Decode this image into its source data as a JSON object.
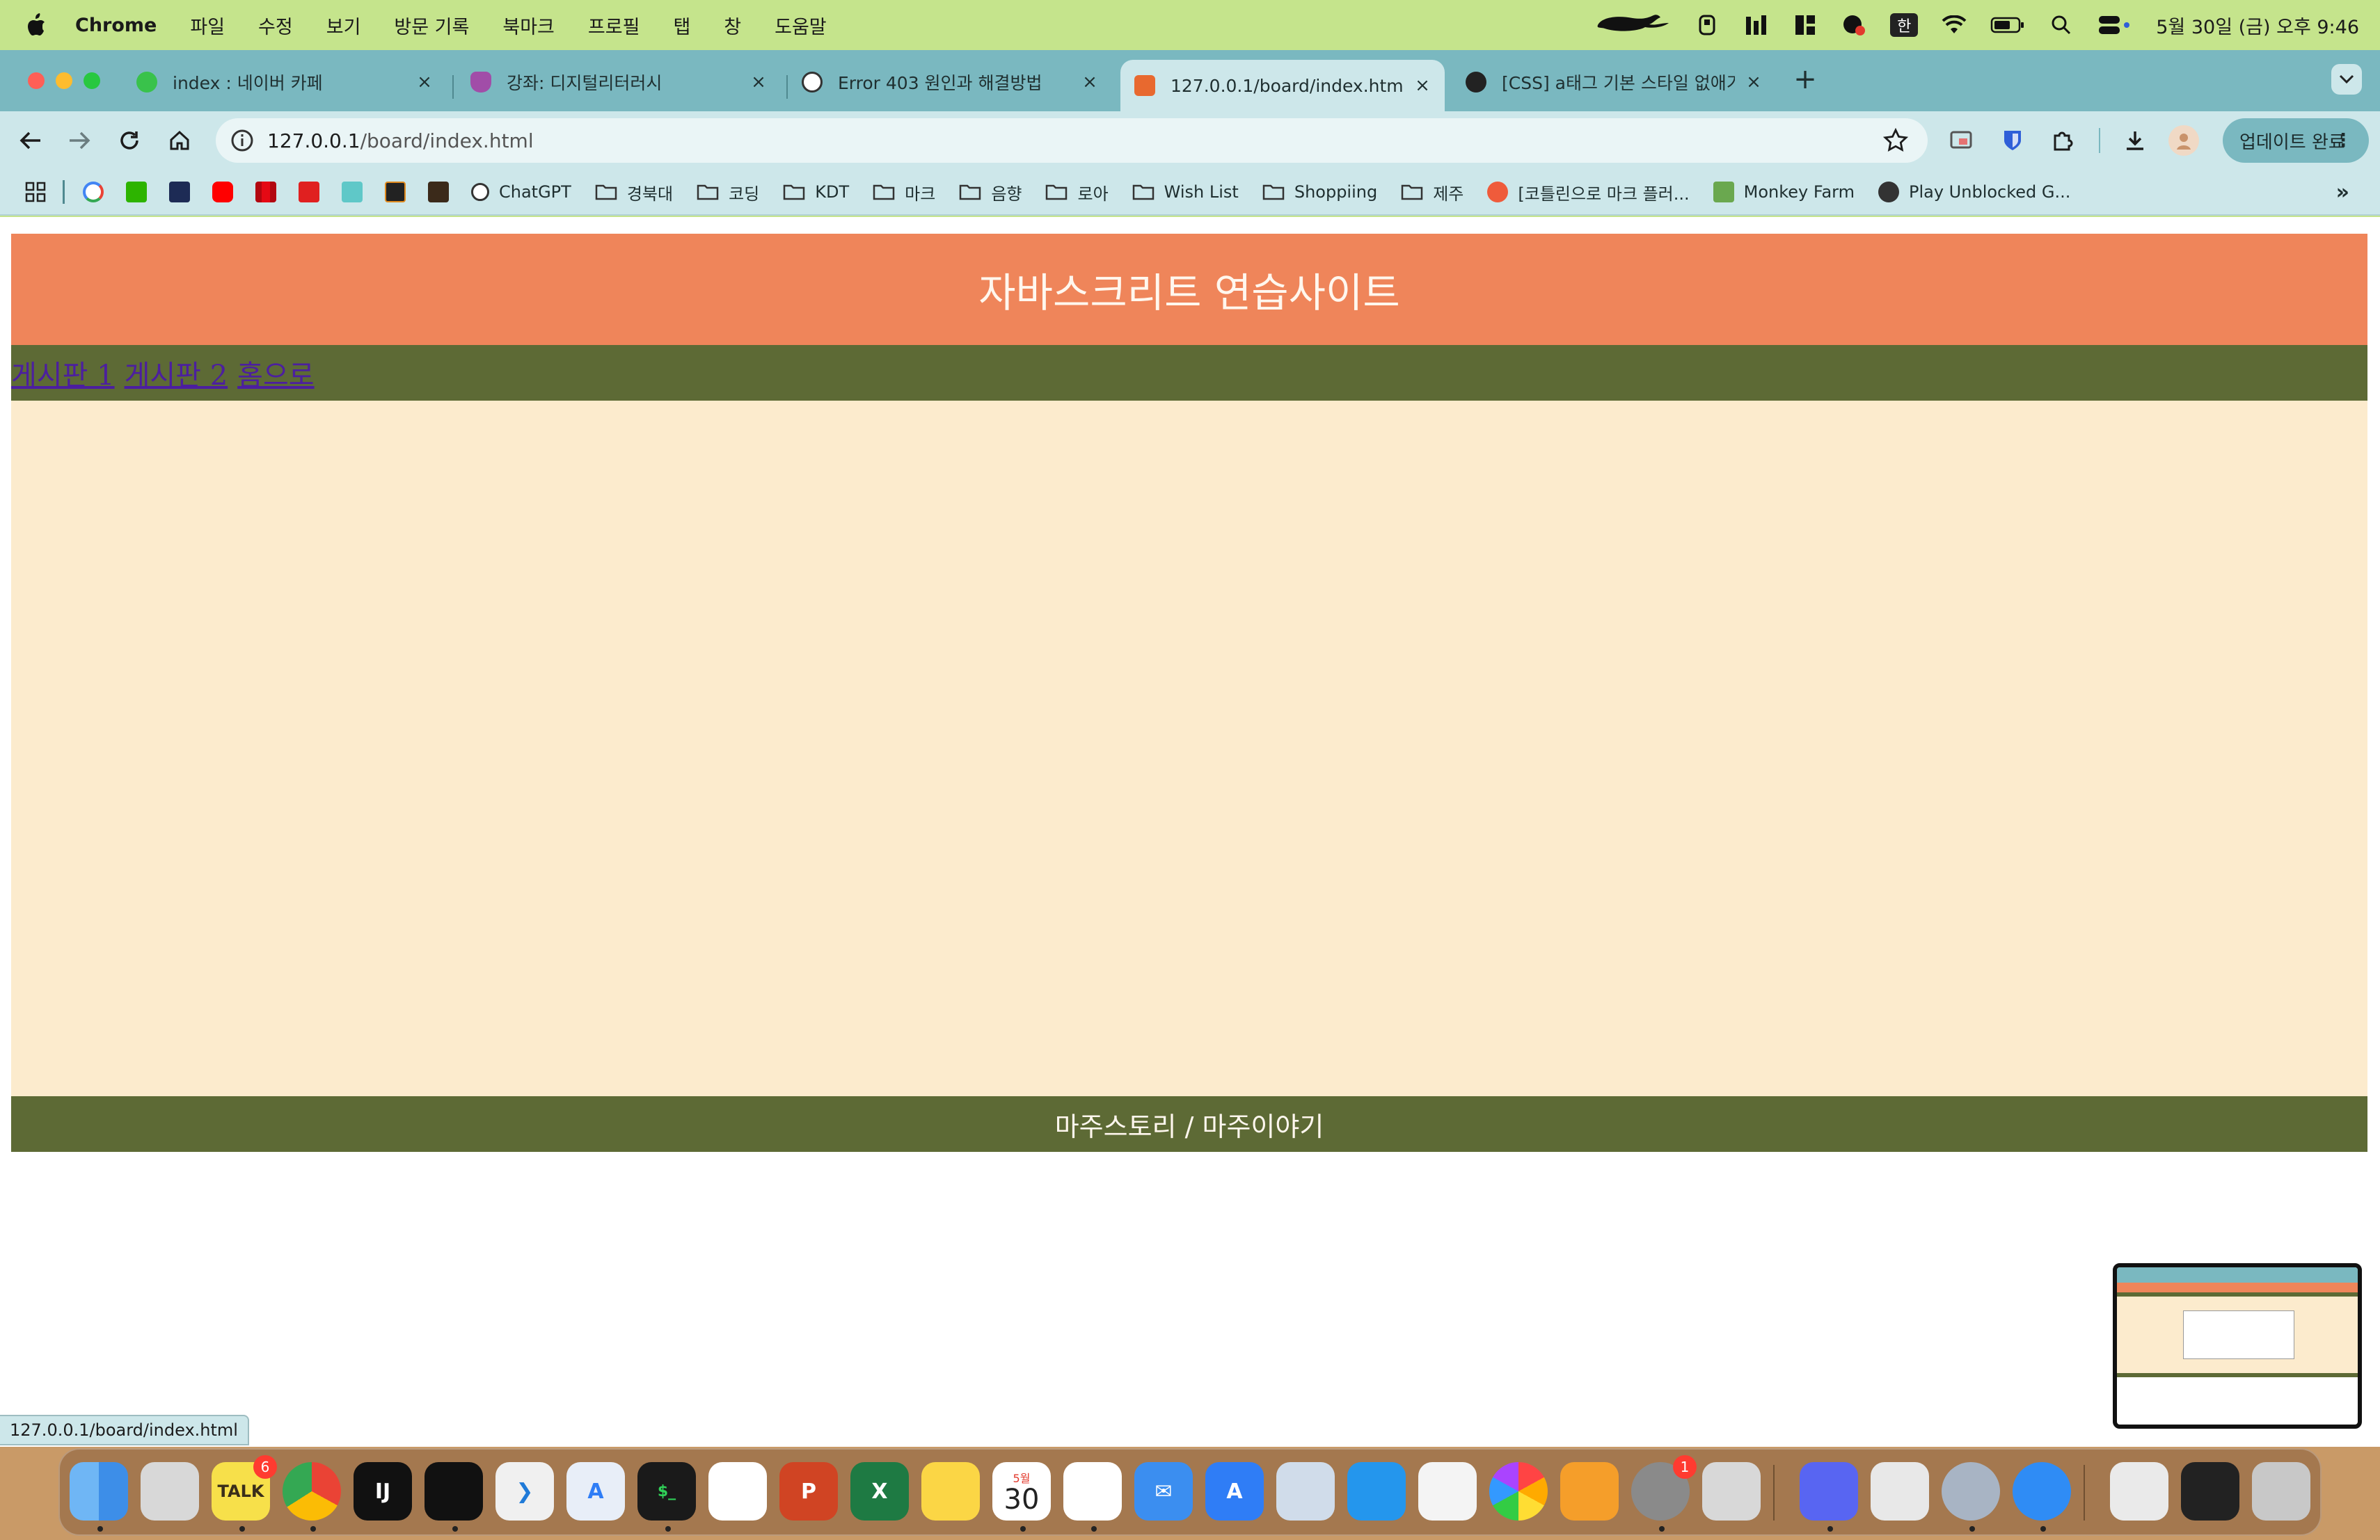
{
  "menubar": {
    "app_name": "Chrome",
    "items": [
      "파일",
      "수정",
      "보기",
      "방문 기록",
      "북마크",
      "프로필",
      "탭",
      "창",
      "도움말"
    ],
    "input_method": "한",
    "clock": "5월 30일 (금) 오후 9:46"
  },
  "tabs": [
    {
      "title": "index : 네이버 카페",
      "icon": "naver-cafe-icon",
      "active": false
    },
    {
      "title": "강좌: 디지털리터러시",
      "icon": "course-shield-icon",
      "active": false
    },
    {
      "title": "Error 403 원인과 해결방법",
      "icon": "openai-icon",
      "active": false
    },
    {
      "title": "127.0.0.1/board/index.html",
      "icon": "html-file-icon",
      "active": true
    },
    {
      "title": "[CSS] a태그 기본 스타일 없애기/...",
      "icon": "paw-icon",
      "active": false
    }
  ],
  "toolbar": {
    "url_host": "127.0.0.1",
    "url_path": "/board/index.html",
    "update_label": "업데이트 완료"
  },
  "bookmarks": [
    {
      "label": "",
      "icon": "google-icon",
      "color": "#ffffff"
    },
    {
      "label": "",
      "icon": "naver-icon",
      "color": "#2db400"
    },
    {
      "label": "",
      "icon": "d-icon",
      "color": "#1d2b55"
    },
    {
      "label": "",
      "icon": "youtube-icon",
      "color": "#ff0000"
    },
    {
      "label": "",
      "icon": "netflix-icon",
      "color": "#cdcdcd"
    },
    {
      "label": "",
      "icon": "v-icon",
      "color": "#e02020"
    },
    {
      "label": "",
      "icon": "teal-square-icon",
      "color": "#5fc8c8"
    },
    {
      "label": "",
      "icon": "m-icon",
      "color": "#222222"
    },
    {
      "label": "",
      "icon": "game-icon",
      "color": "#3b2a1a"
    },
    {
      "label": "ChatGPT",
      "icon": "openai-icon"
    },
    {
      "label": "경북대",
      "icon": "folder-icon"
    },
    {
      "label": "코딩",
      "icon": "folder-icon"
    },
    {
      "label": "KDT",
      "icon": "folder-icon"
    },
    {
      "label": "마크",
      "icon": "folder-icon"
    },
    {
      "label": "음향",
      "icon": "folder-icon"
    },
    {
      "label": "로아",
      "icon": "folder-icon"
    },
    {
      "label": "Wish List",
      "icon": "folder-icon"
    },
    {
      "label": "Shoppiing",
      "icon": "folder-icon"
    },
    {
      "label": "제주",
      "icon": "folder-icon"
    },
    {
      "label": "[코틀린으로 마크 플러...",
      "icon": "tistory-icon"
    },
    {
      "label": "Monkey Farm",
      "icon": "monkey-farm-icon"
    },
    {
      "label": "Play Unblocked G...",
      "icon": "globe-icon"
    }
  ],
  "page": {
    "header_title": "자바스크리트 연습사이트",
    "nav_links": [
      "게시판 1",
      "게시판 2",
      "홈으로"
    ],
    "footer_text": "마주스토리 / 마주이야기"
  },
  "status_url": "127.0.0.1/board/index.html",
  "dock": {
    "apps": [
      {
        "name": "finder-icon",
        "color": "#3d8ee8",
        "label": ""
      },
      {
        "name": "launchpad-icon",
        "color": "#d8d8d8",
        "label": ""
      },
      {
        "name": "kakaotalk-icon",
        "color": "#f7e04a",
        "label": "TALK",
        "badge": "6"
      },
      {
        "name": "chrome-icon",
        "color": "#e8e8e8",
        "label": ""
      },
      {
        "name": "intellij-icon",
        "color": "#111111",
        "label": "IJ"
      },
      {
        "name": "unity-icon",
        "color": "#111111",
        "label": ""
      },
      {
        "name": "vscode-icon",
        "color": "#f0f0f0",
        "label": ""
      },
      {
        "name": "xcode-instruments-icon",
        "color": "#e8eef8",
        "label": ""
      },
      {
        "name": "terminal-icon",
        "color": "#1a1a1a",
        "label": "$_"
      },
      {
        "name": "freeform-icon",
        "color": "#ffffff",
        "label": ""
      },
      {
        "name": "powerpoint-icon",
        "color": "#d04423",
        "label": "P"
      },
      {
        "name": "excel-icon",
        "color": "#1e7a43",
        "label": "X"
      },
      {
        "name": "notes-icon",
        "color": "#fbd645",
        "label": ""
      },
      {
        "name": "calendar-icon",
        "color": "#ffffff",
        "label": "30",
        "sub": "5월"
      },
      {
        "name": "reminders-icon",
        "color": "#ffffff",
        "label": ""
      },
      {
        "name": "mail-icon",
        "color": "#3b8ef0",
        "label": ""
      },
      {
        "name": "app-store-icon",
        "color": "#2f7df6",
        "label": ""
      },
      {
        "name": "disk-utility-icon",
        "color": "#d0dcea",
        "label": ""
      },
      {
        "name": "docker-icon",
        "color": "#2496ed",
        "label": ""
      },
      {
        "name": "pixelmator-icon",
        "color": "#f4f4f4",
        "label": ""
      },
      {
        "name": "photos-icon",
        "color": "#ffffff",
        "label": ""
      },
      {
        "name": "pages-icon",
        "color": "#f59e2a",
        "label": ""
      },
      {
        "name": "system-settings-icon",
        "color": "#8a8a8a",
        "label": "",
        "badge": "1"
      },
      {
        "name": "iphone-mirroring-icon",
        "color": "#d8d8d8",
        "label": ""
      },
      {
        "name": "discord-icon",
        "color": "#5865f2",
        "label": ""
      },
      {
        "name": "textedit-icon",
        "color": "#e8e8e8",
        "label": ""
      },
      {
        "name": "settings-gear-icon",
        "color": "#a8b4c4",
        "label": ""
      },
      {
        "name": "safari-icon",
        "color": "#2f8cf5",
        "label": ""
      },
      {
        "name": "downloads-stack-icon",
        "color": "#eaeaea",
        "label": ""
      },
      {
        "name": "screen-window-icon",
        "color": "#222222",
        "label": ""
      },
      {
        "name": "trash-icon",
        "color": "#c8c8c8",
        "label": ""
      }
    ]
  }
}
